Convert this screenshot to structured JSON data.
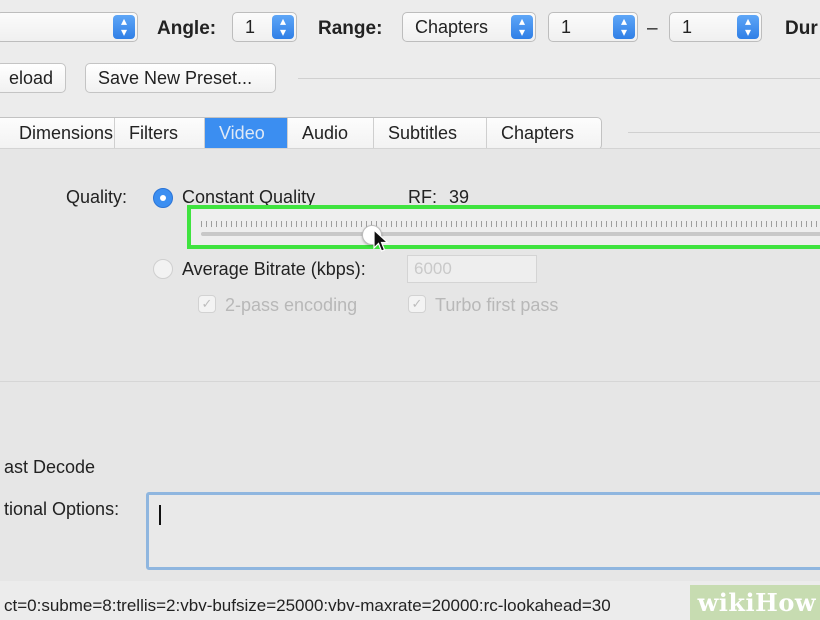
{
  "toolbar": {
    "angle_label": "Angle:",
    "angle_value": "1",
    "range_label": "Range:",
    "range_type": "Chapters",
    "range_start": "1",
    "range_separator": "–",
    "range_end": "1",
    "duration_label": "Dur"
  },
  "presets": {
    "reload_label": "eload",
    "save_new_label": "Save New Preset..."
  },
  "tabs": [
    {
      "label": "Dimensions"
    },
    {
      "label": "Filters"
    },
    {
      "label": "Video",
      "active": true
    },
    {
      "label": "Audio"
    },
    {
      "label": "Subtitles"
    },
    {
      "label": "Chapters"
    }
  ],
  "quality": {
    "label": "Quality:",
    "constant_label": "Constant Quality",
    "constant_selected": true,
    "rf_label": "RF:",
    "rf_value": "39",
    "average_label": "Average Bitrate (kbps):",
    "bitrate_value": "6000",
    "two_pass_label": "2-pass encoding",
    "turbo_label": "Turbo first pass",
    "slider_fraction": 0.27
  },
  "options": {
    "fast_decode_label": "ast Decode",
    "additional_label": "tional Options:",
    "advanced_string": "ct=0:subme=8:trellis=2:vbv-bufsize=25000:vbv-maxrate=20000:rc-lookahead=30"
  },
  "watermark": "wikiHow",
  "colors": {
    "accent": "#3b8ef1",
    "highlight": "#3fe33f",
    "background": "#ececec"
  }
}
